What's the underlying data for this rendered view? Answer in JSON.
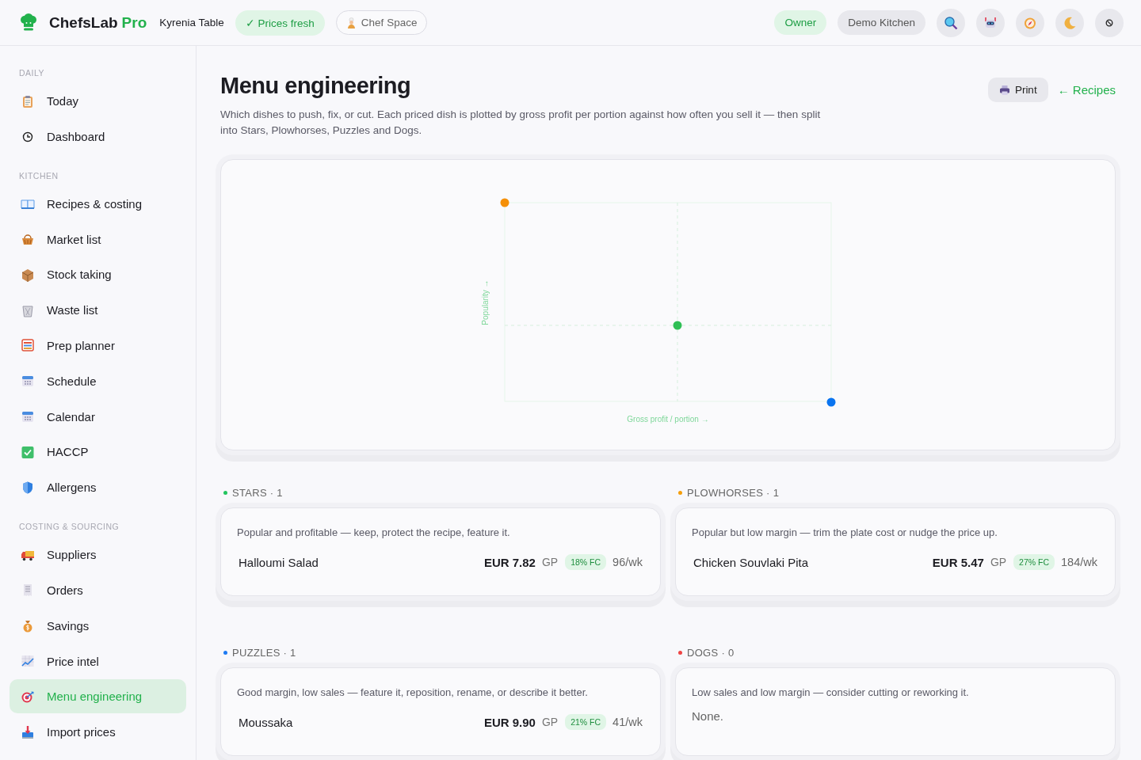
{
  "topbar": {
    "brand": "ChefsLab",
    "brand_tier": "Pro",
    "venue": "Kyrenia Table",
    "status_pill": "✓ Prices fresh",
    "space_button": "Chef Space",
    "role_pill": "Owner",
    "kitchen_pill": "Demo Kitchen"
  },
  "sidebar": {
    "sections": [
      {
        "heading": "DAILY",
        "items": [
          {
            "label": "Today",
            "selected": false
          },
          {
            "label": "Dashboard",
            "selected": false
          }
        ]
      },
      {
        "heading": "KITCHEN",
        "items": [
          {
            "label": "Recipes & costing",
            "selected": false
          },
          {
            "label": "Market list",
            "selected": false
          },
          {
            "label": "Stock taking",
            "selected": false
          },
          {
            "label": "Waste list",
            "selected": false
          },
          {
            "label": "Prep planner",
            "selected": false
          },
          {
            "label": "Schedule",
            "selected": false
          },
          {
            "label": "Calendar",
            "selected": false
          },
          {
            "label": "HACCP",
            "selected": false
          },
          {
            "label": "Allergens",
            "selected": false
          }
        ]
      },
      {
        "heading": "COSTING & SOURCING",
        "items": [
          {
            "label": "Suppliers",
            "selected": false
          },
          {
            "label": "Orders",
            "selected": false
          },
          {
            "label": "Savings",
            "selected": false
          },
          {
            "label": "Price intel",
            "selected": false
          },
          {
            "label": "Menu engineering",
            "selected": true
          },
          {
            "label": "Import prices",
            "selected": false
          }
        ]
      }
    ]
  },
  "page": {
    "title": "Menu engineering",
    "description": "Which dishes to push, fix, or cut. Each priced dish is plotted by gross profit per portion against how often you sell it — then split into Stars, Plowhorses, Puzzles and Dogs.",
    "print_button": "Print",
    "back_link": "← Recipes"
  },
  "chart": {
    "xlabel": "Gross profit / portion →",
    "ylabel": "Popularity →"
  },
  "quadrants": [
    {
      "title": "STARS · 1",
      "color": "#22c55e",
      "description": "Popular and profitable — keep, protect the recipe, feature it.",
      "dishes": [
        {
          "name": "Halloumi Salad",
          "gp": "EUR 7.82",
          "gp_label": "GP",
          "fc": "18% FC",
          "sales": "96/wk"
        }
      ]
    },
    {
      "title": "PLOWHORSES · 1",
      "color": "#f59e0b",
      "description": "Popular but low margin — trim the plate cost or nudge the price up.",
      "dishes": [
        {
          "name": "Chicken Souvlaki Pita",
          "gp": "EUR 5.47",
          "gp_label": "GP",
          "fc": "27% FC",
          "sales": "184/wk"
        }
      ]
    },
    {
      "title": "PUZZLES · 1",
      "color": "#1d7af3",
      "description": "Good margin, low sales — feature it, reposition, rename, or describe it better.",
      "dishes": [
        {
          "name": "Moussaka",
          "gp": "EUR 9.90",
          "gp_label": "GP",
          "fc": "21% FC",
          "sales": "41/wk"
        }
      ]
    },
    {
      "title": "DOGS · 0",
      "color": "#ef4444",
      "description": "Low sales and low margin — consider cutting or reworking it.",
      "empty_text": "None."
    }
  ]
}
